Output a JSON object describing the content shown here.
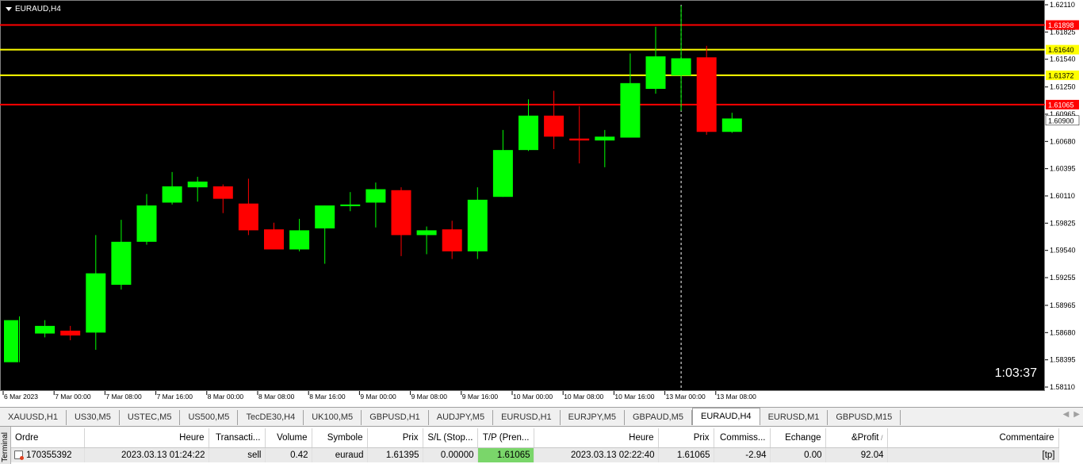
{
  "window": {
    "symbol": "EURAUD,H4",
    "countdown": "1:03:37"
  },
  "colors": {
    "background": "#000000",
    "bull": "#00ff00",
    "bear": "#ff0000",
    "red_line": "#ff0000",
    "yellow_line": "#ffff00",
    "axis_text": "#000000"
  },
  "chart_data": {
    "type": "candlestick",
    "ylim": [
      1.5811,
      1.6211
    ],
    "price_ticks": [
      "1.62110",
      "1.61825",
      "1.61540",
      "1.61250",
      "1.60965",
      "1.60680",
      "1.60395",
      "1.60110",
      "1.59825",
      "1.59540",
      "1.59255",
      "1.58965",
      "1.58680",
      "1.58395",
      "1.58110"
    ],
    "time_ticks": [
      "6 Mar 2023",
      "7 Mar 00:00",
      "7 Mar 08:00",
      "7 Mar 16:00",
      "8 Mar 00:00",
      "8 Mar 08:00",
      "8 Mar 16:00",
      "9 Mar 00:00",
      "9 Mar 08:00",
      "9 Mar 16:00",
      "10 Mar 00:00",
      "10 Mar 08:00",
      "10 Mar 16:00",
      "13 Mar 00:00",
      "13 Mar 08:00"
    ],
    "candles": [
      {
        "o": 1.5837,
        "h": 1.5885,
        "l": 1.5837,
        "c": 1.5881
      },
      {
        "o": 1.5867,
        "h": 1.5881,
        "l": 1.5863,
        "c": 1.5875
      },
      {
        "o": 1.587,
        "h": 1.5875,
        "l": 1.586,
        "c": 1.5865
      },
      {
        "o": 1.5868,
        "h": 1.597,
        "l": 1.585,
        "c": 1.593
      },
      {
        "o": 1.5918,
        "h": 1.5986,
        "l": 1.5913,
        "c": 1.5963
      },
      {
        "o": 1.5963,
        "h": 1.6013,
        "l": 1.596,
        "c": 1.6001
      },
      {
        "o": 1.6004,
        "h": 1.6036,
        "l": 1.6002,
        "c": 1.6021
      },
      {
        "o": 1.602,
        "h": 1.6031,
        "l": 1.6005,
        "c": 1.6026
      },
      {
        "o": 1.6021,
        "h": 1.6023,
        "l": 1.5993,
        "c": 1.6008
      },
      {
        "o": 1.6003,
        "h": 1.6029,
        "l": 1.597,
        "c": 1.5975
      },
      {
        "o": 1.5976,
        "h": 1.5983,
        "l": 1.5955,
        "c": 1.5955
      },
      {
        "o": 1.5955,
        "h": 1.5987,
        "l": 1.5953,
        "c": 1.5975
      },
      {
        "o": 1.5977,
        "h": 1.6001,
        "l": 1.594,
        "c": 1.6001
      },
      {
        "o": 1.6001,
        "h": 1.6015,
        "l": 1.5995,
        "c": 1.6002
      },
      {
        "o": 1.6004,
        "h": 1.6025,
        "l": 1.5978,
        "c": 1.6018
      },
      {
        "o": 1.6017,
        "h": 1.602,
        "l": 1.5948,
        "c": 1.597
      },
      {
        "o": 1.597,
        "h": 1.5979,
        "l": 1.595,
        "c": 1.5975
      },
      {
        "o": 1.5976,
        "h": 1.5985,
        "l": 1.5945,
        "c": 1.5953
      },
      {
        "o": 1.5953,
        "h": 1.602,
        "l": 1.5945,
        "c": 1.6007
      },
      {
        "o": 1.601,
        "h": 1.608,
        "l": 1.601,
        "c": 1.6059
      },
      {
        "o": 1.6059,
        "h": 1.6112,
        "l": 1.6058,
        "c": 1.6095
      },
      {
        "o": 1.6095,
        "h": 1.6121,
        "l": 1.606,
        "c": 1.6073
      },
      {
        "o": 1.6071,
        "h": 1.6105,
        "l": 1.6045,
        "c": 1.6069
      },
      {
        "o": 1.6069,
        "h": 1.608,
        "l": 1.6041,
        "c": 1.6073
      },
      {
        "o": 1.6072,
        "h": 1.616,
        "l": 1.6072,
        "c": 1.6129
      },
      {
        "o": 1.6123,
        "h": 1.6188,
        "l": 1.6118,
        "c": 1.6157
      },
      {
        "o": 1.6137,
        "h": 1.621,
        "l": 1.61,
        "c": 1.6155
      },
      {
        "o": 1.6156,
        "h": 1.6168,
        "l": 1.6075,
        "c": 1.6078
      },
      {
        "o": 1.6078,
        "h": 1.6098,
        "l": 1.6077,
        "c": 1.6092
      }
    ],
    "levels": [
      {
        "price": 1.61898,
        "label": "1.61898",
        "kind": "red"
      },
      {
        "price": 1.6164,
        "label": "1.61640",
        "kind": "yellow"
      },
      {
        "price": 1.61372,
        "label": "1.61372",
        "kind": "yellow"
      },
      {
        "price": 1.61065,
        "label": "1.61065",
        "kind": "red"
      }
    ],
    "current_price": {
      "price": 1.609,
      "label": "1.60900"
    },
    "crosshair_candle_index": 26
  },
  "tabs": [
    {
      "label": "XAUUSD,H1",
      "active": false
    },
    {
      "label": "US30,M5",
      "active": false
    },
    {
      "label": "USTEC,M5",
      "active": false
    },
    {
      "label": "US500,M5",
      "active": false
    },
    {
      "label": "TecDE30,H4",
      "active": false
    },
    {
      "label": "UK100,M5",
      "active": false
    },
    {
      "label": "GBPUSD,H1",
      "active": false
    },
    {
      "label": "AUDJPY,M5",
      "active": false
    },
    {
      "label": "EURUSD,H1",
      "active": false
    },
    {
      "label": "EURJPY,M5",
      "active": false
    },
    {
      "label": "GBPAUD,M5",
      "active": false
    },
    {
      "label": "EURAUD,H4",
      "active": true
    },
    {
      "label": "EURUSD,M1",
      "active": false
    },
    {
      "label": "GBPUSD,M15",
      "active": false
    }
  ],
  "terminal": {
    "side_label": "Terminal",
    "columns": [
      "Ordre",
      "Heure",
      "Transacti...",
      "Volume",
      "Symbole",
      "Prix",
      "S/L (Stop...",
      "T/P (Pren...",
      "Heure",
      "Prix",
      "Commiss...",
      "Echange",
      "&Profit",
      "Commentaire"
    ],
    "sort_marker": "/",
    "rows": [
      [
        "170355392",
        "2023.03.13 01:24:22",
        "sell",
        "0.42",
        "euraud",
        "1.61395",
        "0.00000",
        "1.61065",
        "2023.03.13 02:22:40",
        "1.61065",
        "-2.94",
        "0.00",
        "92.04",
        "[tp]"
      ]
    ]
  }
}
